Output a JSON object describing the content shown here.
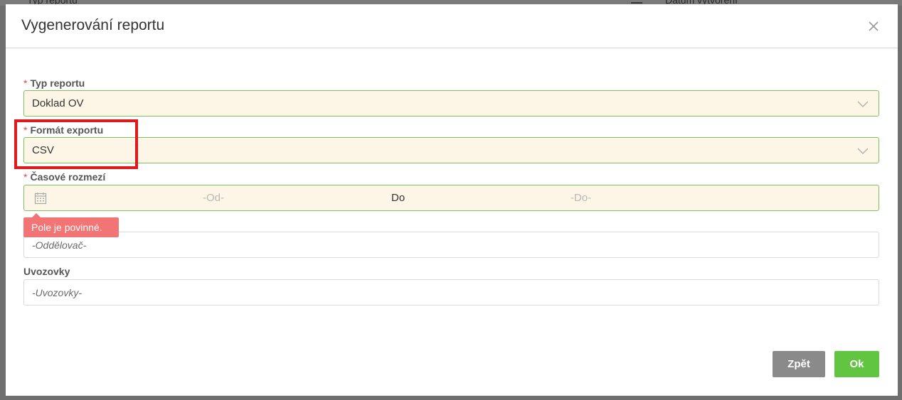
{
  "background": {
    "col1_header": "Typ reportu",
    "col2_header": "Datum vytvoření"
  },
  "modal": {
    "title": "Vygenerování reportu",
    "close_icon": "close-icon"
  },
  "form": {
    "report_type": {
      "label": "Typ reportu",
      "required_mark": "*",
      "value": "Doklad OV"
    },
    "export_format": {
      "label": "Formát exportu",
      "required_mark": "*",
      "value": "CSV"
    },
    "time_range": {
      "label": "Časové rozmezí",
      "required_mark": "*",
      "from_placeholder": "-Od-",
      "separator": "Do",
      "to_placeholder": "-Do-",
      "icon": "calendar-icon",
      "error_message": "Pole je povinné."
    },
    "separator_field": {
      "placeholder": "-Oddělovač-"
    },
    "quotes": {
      "label": "Uvozovky",
      "placeholder": "-Uvozovky-"
    }
  },
  "buttons": {
    "back": "Zpět",
    "ok": "Ok"
  },
  "colors": {
    "valid_border": "#7ac35f",
    "field_fill": "#fdf6e6",
    "error": "#f27474",
    "ok_button": "#62c542",
    "back_button": "#8a8a8a",
    "highlight": "#e01a1a"
  }
}
